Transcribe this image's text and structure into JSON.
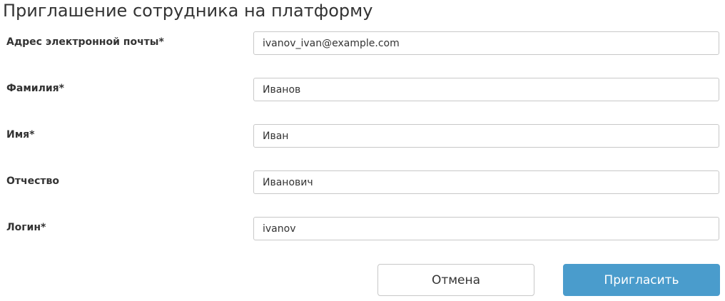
{
  "form": {
    "title": "Приглашение сотрудника на платформу",
    "fields": [
      {
        "label": "Адрес электронной почты*",
        "value": "ivanov_ivan@example.com"
      },
      {
        "label": "Фамилия*",
        "value": "Иванов"
      },
      {
        "label": "Имя*",
        "value": "Иван"
      },
      {
        "label": "Отчество",
        "value": "Иванович"
      },
      {
        "label": "Логин*",
        "value": "ivanov"
      }
    ],
    "buttons": {
      "cancel_label": "Отмена",
      "invite_label": "Пригласить"
    }
  },
  "colors": {
    "primary": "#4a9ccc",
    "border": "#c8c8c8",
    "text": "#333333"
  }
}
